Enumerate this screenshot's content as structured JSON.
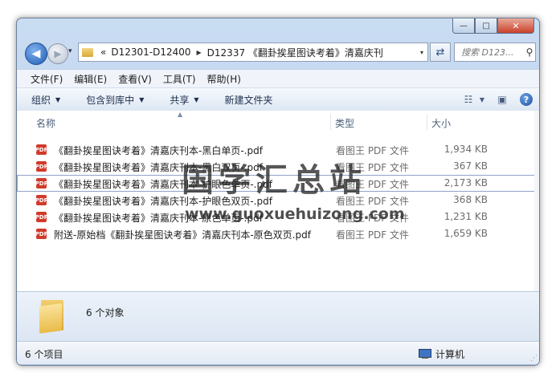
{
  "window": {
    "minimize_glyph": "—",
    "maximize_glyph": "□",
    "close_glyph": "✕"
  },
  "address": {
    "overflow": "«",
    "crumbs": [
      "D12301-D12400",
      "D12337 《翻卦挨星图诀考着》清嘉庆刊"
    ],
    "separator": "▶",
    "dropdown": "▾"
  },
  "search": {
    "placeholder": "搜索 D123..."
  },
  "menu": {
    "items": [
      "文件(F)",
      "编辑(E)",
      "查看(V)",
      "工具(T)",
      "帮助(H)"
    ]
  },
  "toolbar": {
    "organize": "组织",
    "include_in_library": "包含到库中",
    "share": "共享",
    "new_folder": "新建文件夹",
    "help": "?"
  },
  "columns": {
    "name": "名称",
    "type": "类型",
    "size": "大小"
  },
  "files": [
    {
      "name": "《翻卦挨星图诀考着》清嘉庆刊本-黑白单页-.pdf",
      "type": "看图王 PDF 文件",
      "size": "1,934 KB"
    },
    {
      "name": "《翻卦挨星图诀考着》清嘉庆刊本-黑白双页-.pdf",
      "type": "看图王 PDF 文件",
      "size": "367 KB"
    },
    {
      "name": "《翻卦挨星图诀考着》清嘉庆刊本-护眼色单页-.pdf",
      "type": "看图王 PDF 文件",
      "size": "2,173 KB"
    },
    {
      "name": "《翻卦挨星图诀考着》清嘉庆刊本-护眼色双页-.pdf",
      "type": "看图王 PDF 文件",
      "size": "368 KB"
    },
    {
      "name": "《翻卦挨星图诀考着》清嘉庆刊本-原色单页-.pdf",
      "type": "看图王 PDF 文件",
      "size": "1,231 KB"
    },
    {
      "name": "附送-原始档《翻卦挨星图诀考着》清嘉庆刊本-原色双页.pdf",
      "type": "看图王 PDF 文件",
      "size": "1,659 KB"
    }
  ],
  "pdf_badge": "PDF",
  "watermark": {
    "chinese": "国学汇总站",
    "url": "www.guoxuehuizong.com"
  },
  "details": {
    "object_count": "6 个对象"
  },
  "status": {
    "item_count": "6 个项目",
    "location": "计算机"
  },
  "icons": {
    "back": "back-arrow-icon",
    "forward": "forward-arrow-icon",
    "refresh": "refresh-icon",
    "search": "search-icon",
    "view": "view-options-icon",
    "preview": "preview-pane-icon",
    "help": "help-icon",
    "folder": "folder-icon",
    "computer": "computer-icon",
    "pdf": "pdf-file-icon"
  }
}
